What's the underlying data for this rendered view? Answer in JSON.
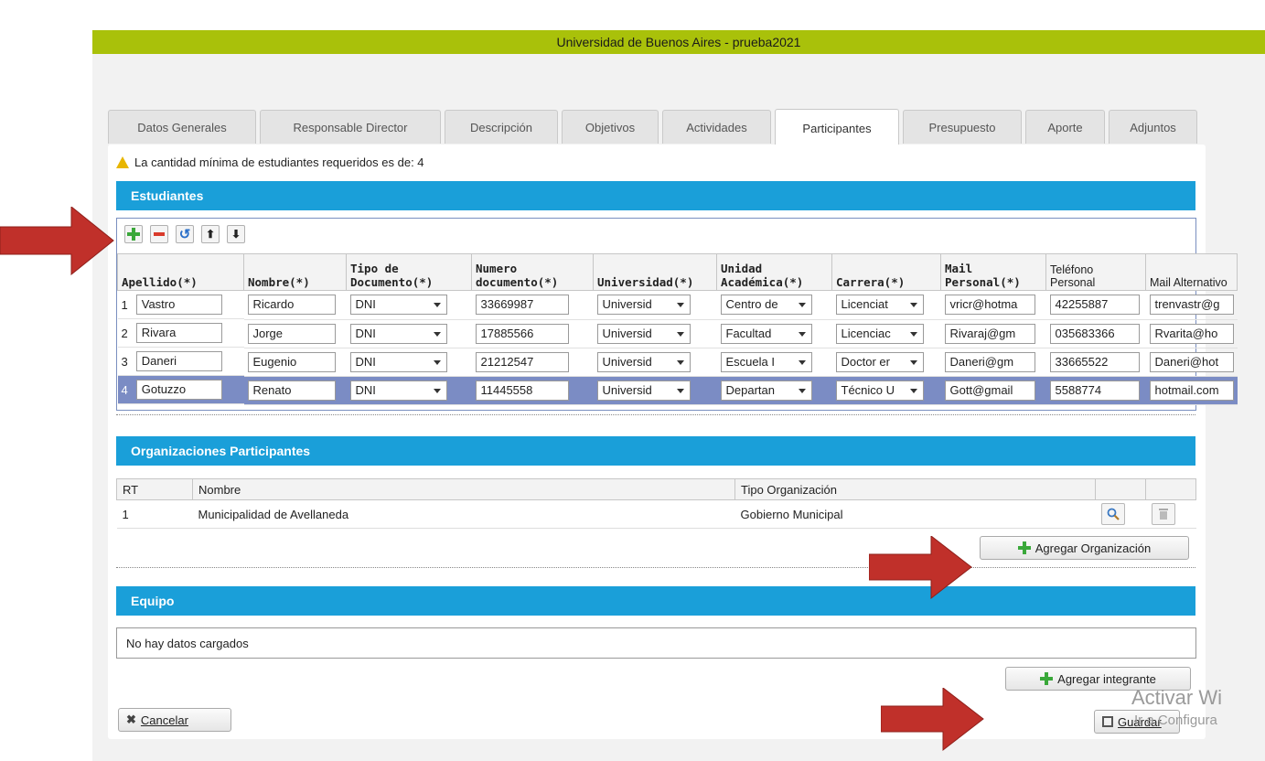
{
  "app_title": "Universidad de Buenos Aires - prueba2021",
  "tabs": [
    "Datos Generales",
    "Responsable Director",
    "Descripción",
    "Objetivos",
    "Actividades",
    "Participantes",
    "Presupuesto",
    "Aporte",
    "Adjuntos"
  ],
  "active_tab": "Participantes",
  "warning": "La cantidad mínima de estudiantes requeridos es de: 4",
  "estudiantes": {
    "title": "Estudiantes",
    "toolbar": [
      "add-icon",
      "remove-icon",
      "undo-icon",
      "move-up-icon",
      "move-down-icon"
    ],
    "headers": [
      "Apellido(*)",
      "Nombre(*)",
      "Tipo de Documento(*)",
      "Numero documento(*)",
      "Universidad(*)",
      "Unidad Académica(*)",
      "Carrera(*)",
      "Mail Personal(*)",
      "Teléfono Personal",
      "Mail Alternativo"
    ],
    "rows": [
      {
        "n": "1",
        "apellido": "Vastro",
        "nombre": "Ricardo",
        "tipo": "DNI",
        "doc": "33669987",
        "univ": "Universid",
        "unidad": "Centro de",
        "carrera": "Licenciat",
        "mail": "vricr@hotma",
        "tel": "42255887",
        "alt": "trenvastr@g"
      },
      {
        "n": "2",
        "apellido": "Rivara",
        "nombre": "Jorge",
        "tipo": "DNI",
        "doc": "17885566",
        "univ": "Universid",
        "unidad": "Facultad",
        "carrera": "Licenciac",
        "mail": "Rivaraj@gm",
        "tel": "035683366",
        "alt": "Rvarita@ho"
      },
      {
        "n": "3",
        "apellido": "Daneri",
        "nombre": "Eugenio",
        "tipo": "DNI",
        "doc": "21212547",
        "univ": "Universid",
        "unidad": "Escuela I",
        "carrera": "Doctor er",
        "mail": "Daneri@gm",
        "tel": "33665522",
        "alt": "Daneri@hot"
      },
      {
        "n": "4",
        "apellido": "Gotuzzo",
        "nombre": "Renato",
        "tipo": "DNI",
        "doc": "11445558",
        "univ": "Universid",
        "unidad": "Departan",
        "carrera": "Técnico U",
        "mail": "Gott@gmail",
        "tel": "5588774",
        "alt": "hotmail.com"
      }
    ]
  },
  "organizaciones": {
    "title": "Organizaciones Participantes",
    "headers": [
      "RT",
      "Nombre",
      "Tipo Organización"
    ],
    "rows": [
      {
        "rt": "1",
        "nombre": "Municipalidad de Avellaneda",
        "tipo": "Gobierno Municipal"
      }
    ],
    "add_label": "Agregar Organización"
  },
  "equipo": {
    "title": "Equipo",
    "empty": "No hay datos cargados",
    "add_label": "Agregar integrante"
  },
  "cancel_label": "Cancelar",
  "save_label": "Guardar",
  "watermark": {
    "line1": "Activar Wi",
    "line2": "Ir a Configura"
  },
  "colors": {
    "topbar": "#a9c10a",
    "section": "#1a9fd9",
    "selected_row": "#7b8cc4",
    "arrow": "#c0302a"
  }
}
